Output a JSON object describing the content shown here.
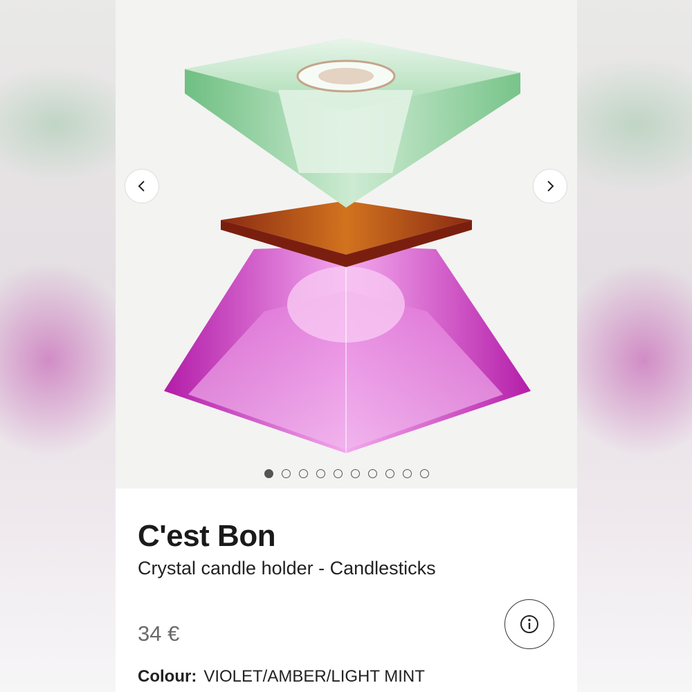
{
  "product": {
    "brand": "C'est Bon",
    "subtitle": "Crystal candle holder - Candlesticks",
    "price": "34 €",
    "colour_label": "Colour:",
    "colour_value": "VIOLET/AMBER/LIGHT MINT"
  },
  "gallery": {
    "image_count": 10,
    "active_index": 0
  },
  "icons": {
    "prev": "chevron-left-icon",
    "next": "chevron-right-icon",
    "info": "info-icon"
  },
  "colors": {
    "mint": "#9fd6a9",
    "amber": "#b8501a",
    "violet": "#d640c8",
    "text": "#1a1a1a",
    "price": "#6a6a6a"
  }
}
